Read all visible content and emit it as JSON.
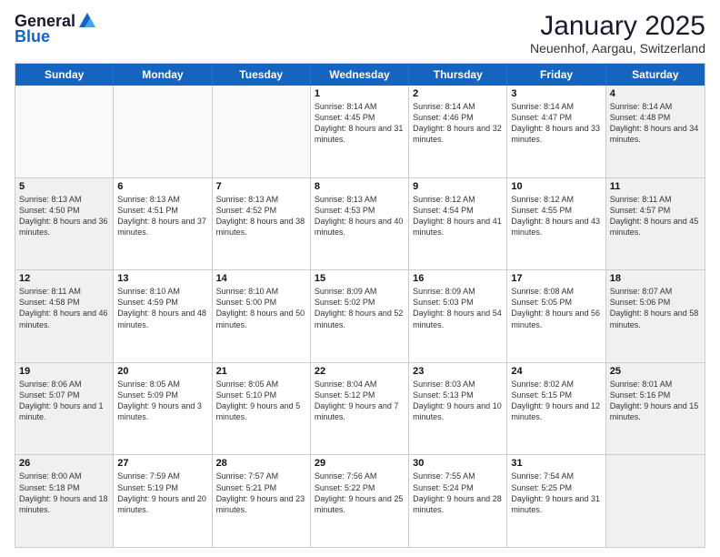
{
  "logo": {
    "general": "General",
    "blue": "Blue"
  },
  "header": {
    "month": "January 2025",
    "location": "Neuenhof, Aargau, Switzerland"
  },
  "days": [
    "Sunday",
    "Monday",
    "Tuesday",
    "Wednesday",
    "Thursday",
    "Friday",
    "Saturday"
  ],
  "weeks": [
    [
      {
        "day": "",
        "empty": true
      },
      {
        "day": "",
        "empty": true
      },
      {
        "day": "",
        "empty": true
      },
      {
        "day": "1",
        "sun": "Sunrise: 8:14 AM",
        "set": "Sunset: 4:45 PM",
        "day_text": "Daylight: 8 hours and 31 minutes."
      },
      {
        "day": "2",
        "sun": "Sunrise: 8:14 AM",
        "set": "Sunset: 4:46 PM",
        "day_text": "Daylight: 8 hours and 32 minutes."
      },
      {
        "day": "3",
        "sun": "Sunrise: 8:14 AM",
        "set": "Sunset: 4:47 PM",
        "day_text": "Daylight: 8 hours and 33 minutes."
      },
      {
        "day": "4",
        "sun": "Sunrise: 8:14 AM",
        "set": "Sunset: 4:48 PM",
        "day_text": "Daylight: 8 hours and 34 minutes.",
        "shaded": true
      }
    ],
    [
      {
        "day": "5",
        "sun": "Sunrise: 8:13 AM",
        "set": "Sunset: 4:50 PM",
        "day_text": "Daylight: 8 hours and 36 minutes.",
        "shaded": true
      },
      {
        "day": "6",
        "sun": "Sunrise: 8:13 AM",
        "set": "Sunset: 4:51 PM",
        "day_text": "Daylight: 8 hours and 37 minutes."
      },
      {
        "day": "7",
        "sun": "Sunrise: 8:13 AM",
        "set": "Sunset: 4:52 PM",
        "day_text": "Daylight: 8 hours and 38 minutes."
      },
      {
        "day": "8",
        "sun": "Sunrise: 8:13 AM",
        "set": "Sunset: 4:53 PM",
        "day_text": "Daylight: 8 hours and 40 minutes."
      },
      {
        "day": "9",
        "sun": "Sunrise: 8:12 AM",
        "set": "Sunset: 4:54 PM",
        "day_text": "Daylight: 8 hours and 41 minutes."
      },
      {
        "day": "10",
        "sun": "Sunrise: 8:12 AM",
        "set": "Sunset: 4:55 PM",
        "day_text": "Daylight: 8 hours and 43 minutes."
      },
      {
        "day": "11",
        "sun": "Sunrise: 8:11 AM",
        "set": "Sunset: 4:57 PM",
        "day_text": "Daylight: 8 hours and 45 minutes.",
        "shaded": true
      }
    ],
    [
      {
        "day": "12",
        "sun": "Sunrise: 8:11 AM",
        "set": "Sunset: 4:58 PM",
        "day_text": "Daylight: 8 hours and 46 minutes.",
        "shaded": true
      },
      {
        "day": "13",
        "sun": "Sunrise: 8:10 AM",
        "set": "Sunset: 4:59 PM",
        "day_text": "Daylight: 8 hours and 48 minutes."
      },
      {
        "day": "14",
        "sun": "Sunrise: 8:10 AM",
        "set": "Sunset: 5:00 PM",
        "day_text": "Daylight: 8 hours and 50 minutes."
      },
      {
        "day": "15",
        "sun": "Sunrise: 8:09 AM",
        "set": "Sunset: 5:02 PM",
        "day_text": "Daylight: 8 hours and 52 minutes."
      },
      {
        "day": "16",
        "sun": "Sunrise: 8:09 AM",
        "set": "Sunset: 5:03 PM",
        "day_text": "Daylight: 8 hours and 54 minutes."
      },
      {
        "day": "17",
        "sun": "Sunrise: 8:08 AM",
        "set": "Sunset: 5:05 PM",
        "day_text": "Daylight: 8 hours and 56 minutes."
      },
      {
        "day": "18",
        "sun": "Sunrise: 8:07 AM",
        "set": "Sunset: 5:06 PM",
        "day_text": "Daylight: 8 hours and 58 minutes.",
        "shaded": true
      }
    ],
    [
      {
        "day": "19",
        "sun": "Sunrise: 8:06 AM",
        "set": "Sunset: 5:07 PM",
        "day_text": "Daylight: 9 hours and 1 minute.",
        "shaded": true
      },
      {
        "day": "20",
        "sun": "Sunrise: 8:05 AM",
        "set": "Sunset: 5:09 PM",
        "day_text": "Daylight: 9 hours and 3 minutes."
      },
      {
        "day": "21",
        "sun": "Sunrise: 8:05 AM",
        "set": "Sunset: 5:10 PM",
        "day_text": "Daylight: 9 hours and 5 minutes."
      },
      {
        "day": "22",
        "sun": "Sunrise: 8:04 AM",
        "set": "Sunset: 5:12 PM",
        "day_text": "Daylight: 9 hours and 7 minutes."
      },
      {
        "day": "23",
        "sun": "Sunrise: 8:03 AM",
        "set": "Sunset: 5:13 PM",
        "day_text": "Daylight: 9 hours and 10 minutes."
      },
      {
        "day": "24",
        "sun": "Sunrise: 8:02 AM",
        "set": "Sunset: 5:15 PM",
        "day_text": "Daylight: 9 hours and 12 minutes."
      },
      {
        "day": "25",
        "sun": "Sunrise: 8:01 AM",
        "set": "Sunset: 5:16 PM",
        "day_text": "Daylight: 9 hours and 15 minutes.",
        "shaded": true
      }
    ],
    [
      {
        "day": "26",
        "sun": "Sunrise: 8:00 AM",
        "set": "Sunset: 5:18 PM",
        "day_text": "Daylight: 9 hours and 18 minutes.",
        "shaded": true
      },
      {
        "day": "27",
        "sun": "Sunrise: 7:59 AM",
        "set": "Sunset: 5:19 PM",
        "day_text": "Daylight: 9 hours and 20 minutes."
      },
      {
        "day": "28",
        "sun": "Sunrise: 7:57 AM",
        "set": "Sunset: 5:21 PM",
        "day_text": "Daylight: 9 hours and 23 minutes."
      },
      {
        "day": "29",
        "sun": "Sunrise: 7:56 AM",
        "set": "Sunset: 5:22 PM",
        "day_text": "Daylight: 9 hours and 25 minutes."
      },
      {
        "day": "30",
        "sun": "Sunrise: 7:55 AM",
        "set": "Sunset: 5:24 PM",
        "day_text": "Daylight: 9 hours and 28 minutes."
      },
      {
        "day": "31",
        "sun": "Sunrise: 7:54 AM",
        "set": "Sunset: 5:25 PM",
        "day_text": "Daylight: 9 hours and 31 minutes."
      },
      {
        "day": "",
        "empty": true,
        "shaded": true
      }
    ]
  ]
}
